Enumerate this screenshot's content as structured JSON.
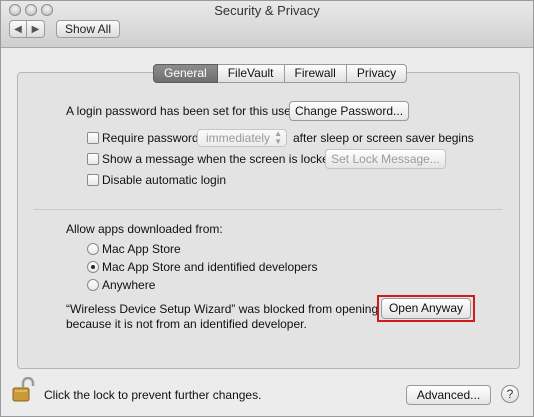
{
  "window": {
    "title": "Security & Privacy",
    "show_all_label": "Show All"
  },
  "tabs": [
    {
      "label": "General",
      "active": true
    },
    {
      "label": "FileVault",
      "active": false
    },
    {
      "label": "Firewall",
      "active": false
    },
    {
      "label": "Privacy",
      "active": false
    }
  ],
  "general": {
    "login_password_text": "A login password has been set for this user",
    "change_password_label": "Change Password...",
    "require_password_label": "Require password",
    "require_password_checked": false,
    "require_password_delay": "immediately",
    "after_sleep_text": "after sleep or screen saver begins",
    "show_message_label": "Show a message when the screen is locked",
    "show_message_checked": false,
    "set_lock_message_label": "Set Lock Message...",
    "disable_auto_login_label": "Disable automatic login",
    "disable_auto_login_checked": false,
    "allow_apps_heading": "Allow apps downloaded from:",
    "options": [
      {
        "label": "Mac App Store",
        "selected": false
      },
      {
        "label": "Mac App Store and identified developers",
        "selected": true
      },
      {
        "label": "Anywhere",
        "selected": false
      }
    ],
    "blocked_line1": "“Wireless Device Setup Wizard” was blocked from opening",
    "blocked_line2": "because it is not from an identified developer.",
    "open_anyway_label": "Open Anyway"
  },
  "footer": {
    "lock_text": "Click the lock to prevent further changes.",
    "advanced_label": "Advanced...",
    "help_label": "?"
  },
  "colors": {
    "highlight": "#d11b1b",
    "active_tab": "#7a7a7a"
  }
}
